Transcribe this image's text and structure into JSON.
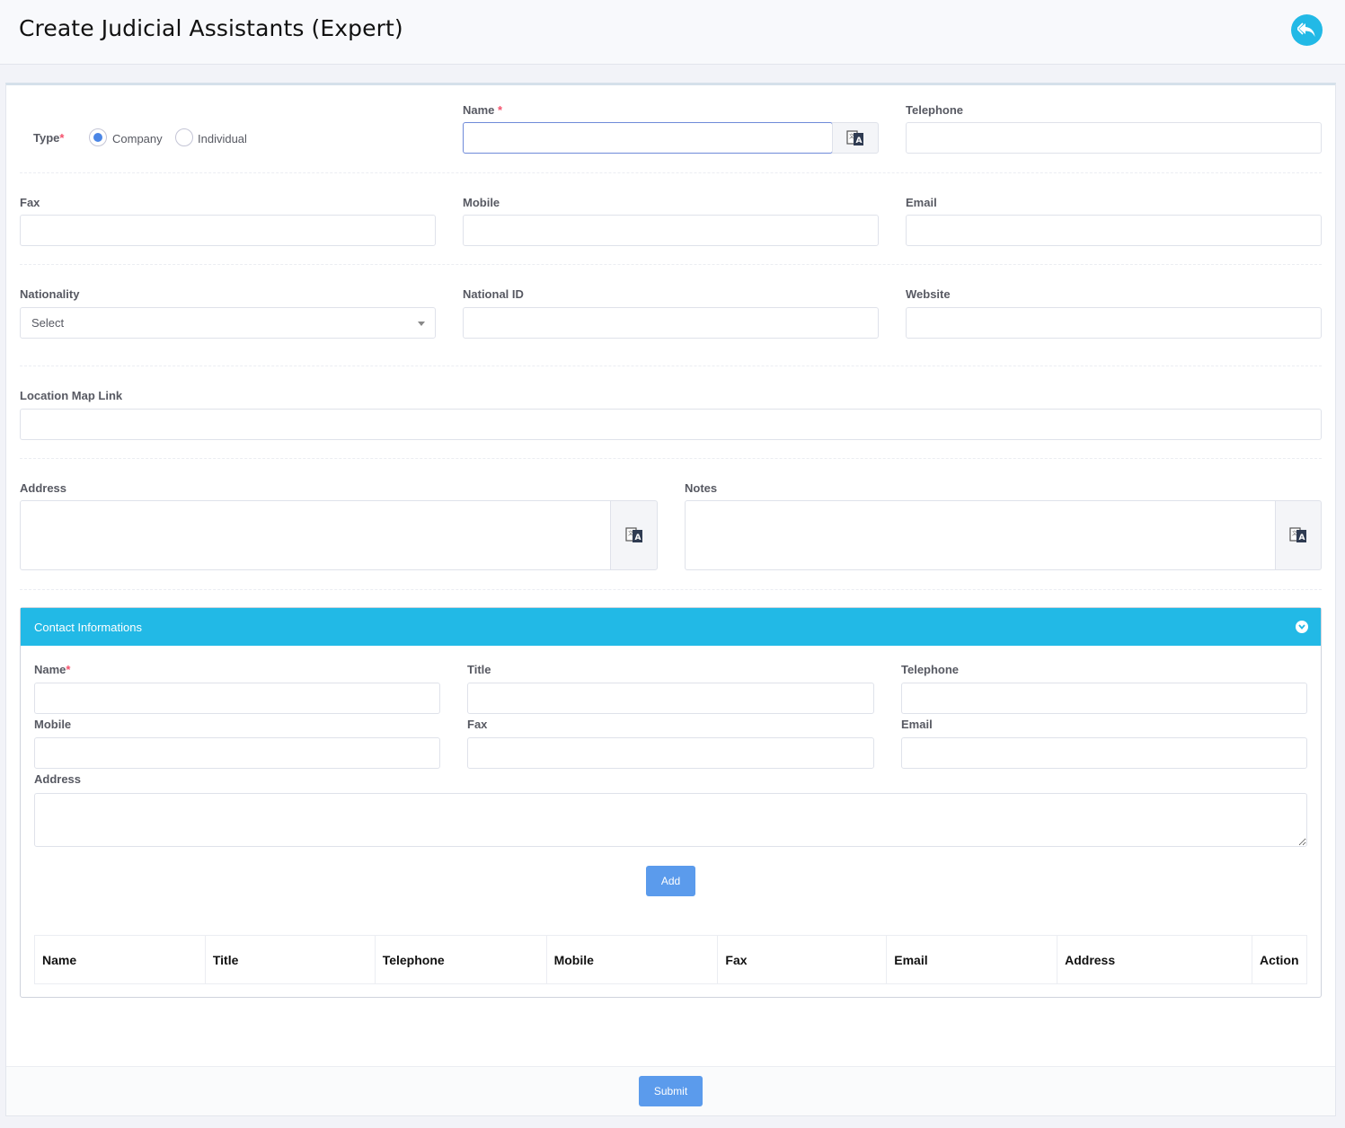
{
  "header": {
    "title": "Create Judicial Assistants (Expert)",
    "back_icon": "reply-icon"
  },
  "form": {
    "type_label": "Type",
    "type_options": [
      "Company",
      "Individual"
    ],
    "type_selected": "Company",
    "name_label": "Name",
    "telephone_label": "Telephone",
    "fax_label": "Fax",
    "mobile_label": "Mobile",
    "email_label": "Email",
    "nationality_label": "Nationality",
    "nationality_value": "Select",
    "national_id_label": "National ID",
    "website_label": "Website",
    "location_label": "Location Map Link",
    "address_label": "Address",
    "notes_label": "Notes",
    "required_mark": "*"
  },
  "contact": {
    "title": "Contact Informations",
    "name_label": "Name",
    "title_label": "Title",
    "telephone_label": "Telephone",
    "mobile_label": "Mobile",
    "fax_label": "Fax",
    "email_label": "Email",
    "address_label": "Address",
    "add_label": "Add",
    "table_headers": [
      "Name",
      "Title",
      "Telephone",
      "Mobile",
      "Fax",
      "Email",
      "Address",
      "Action"
    ]
  },
  "footer": {
    "submit_label": "Submit"
  },
  "colors": {
    "accent": "#22b9e6",
    "button": "#5b9bec",
    "required": "#f4516c"
  }
}
